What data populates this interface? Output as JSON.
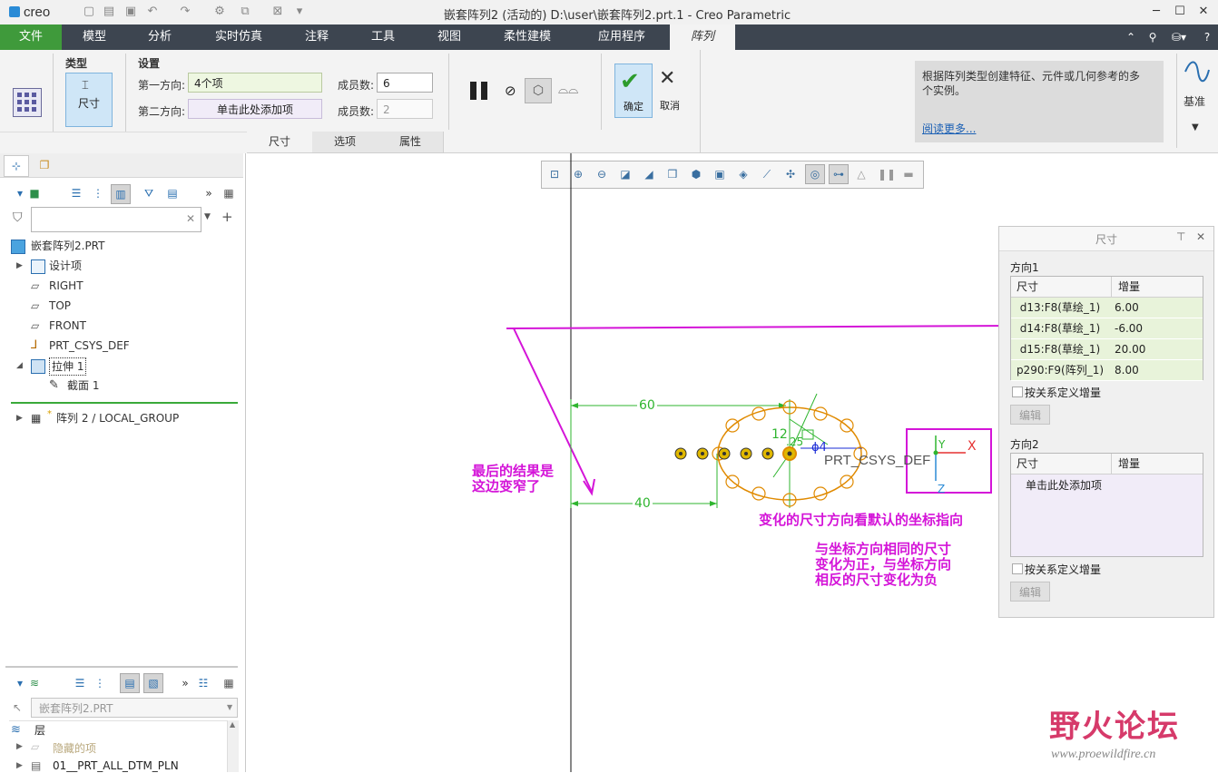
{
  "window": {
    "logo": "creo",
    "title": "嵌套阵列2 (活动的) D:\\user\\嵌套阵列2.prt.1 - Creo Parametric"
  },
  "ribbon_tabs": [
    "文件",
    "模型",
    "分析",
    "实时仿真",
    "注释",
    "工具",
    "视图",
    "柔性建模",
    "应用程序",
    "阵列"
  ],
  "ribbon": {
    "type_label": "类型",
    "type_button": "尺寸",
    "settings_label": "设置",
    "dir1_label": "第一方向:",
    "dir1_value": "4个项",
    "dir2_label": "第二方向:",
    "dir2_value": "单击此处添加项",
    "members1_label": "成员数:",
    "members1_value": "6",
    "members2_label": "成员数:",
    "members2_value": "2",
    "ok_label": "确定",
    "cancel_label": "取消",
    "help_text": "根据阵列类型创建特征、元件或几何参考的多个实例。",
    "help_link": "阅读更多...",
    "datum_label": "基准",
    "subtabs": [
      "尺寸",
      "选项",
      "属性"
    ]
  },
  "model_tree": {
    "root": "嵌套阵列2.PRT",
    "items": [
      {
        "label": "设计项"
      },
      {
        "label": "RIGHT"
      },
      {
        "label": "TOP"
      },
      {
        "label": "FRONT"
      },
      {
        "label": "PRT_CSYS_DEF"
      },
      {
        "label": "拉伸 1"
      },
      {
        "label": "截面 1"
      },
      {
        "label": "阵列 2 / LOCAL_GROUP"
      }
    ]
  },
  "layer_panel": {
    "combo_value": "嵌套阵列2.PRT",
    "header": "层",
    "items": [
      "隐藏的项",
      "01__PRT_ALL_DTM_PLN"
    ]
  },
  "dim_panel": {
    "title": "尺寸",
    "dir1_label": "方向1",
    "col_dim": "尺寸",
    "col_inc": "增量",
    "rows": [
      {
        "dim": "d13:F8(草绘_1)",
        "inc": "6.00"
      },
      {
        "dim": "d14:F8(草绘_1)",
        "inc": "-6.00"
      },
      {
        "dim": "d15:F8(草绘_1)",
        "inc": "20.00"
      },
      {
        "dim": "p290:F9(阵列_1)",
        "inc": "8.00"
      }
    ],
    "relation_check": "按关系定义增量",
    "edit_btn": "编辑",
    "dir2_label": "方向2",
    "dir2_add": "单击此处添加项",
    "relation_check2": "按关系定义增量",
    "edit_btn2": "编辑"
  },
  "graphics": {
    "dim_60": "60",
    "dim_40": "40",
    "dim_12": "12",
    "dim_25": ".25",
    "dim_phi4": "ϕ4",
    "csys_label": "PRT_CSYS_DEF",
    "axis_x": "X",
    "axis_y": "Y",
    "axis_z": "Z"
  },
  "annotations": {
    "left_note_line1": "最后的结果是",
    "left_note_line2": "这边变窄了",
    "center_note": "变化的尺寸方向看默认的坐标指向",
    "rule_note_line1": "与坐标方向相同的尺寸",
    "rule_note_line2": "变化为正，与坐标方向",
    "rule_note_line3": "相反的尺寸变化为负"
  },
  "watermark": {
    "brand": "野火论坛",
    "url": "www.proewildfire.cn"
  },
  "colors": {
    "file_tab": "#3f9a3b",
    "tab_bar": "#3d4550",
    "annotation": "#d414d8",
    "dimension": "#2fb52f",
    "pattern": "#e08a00"
  }
}
